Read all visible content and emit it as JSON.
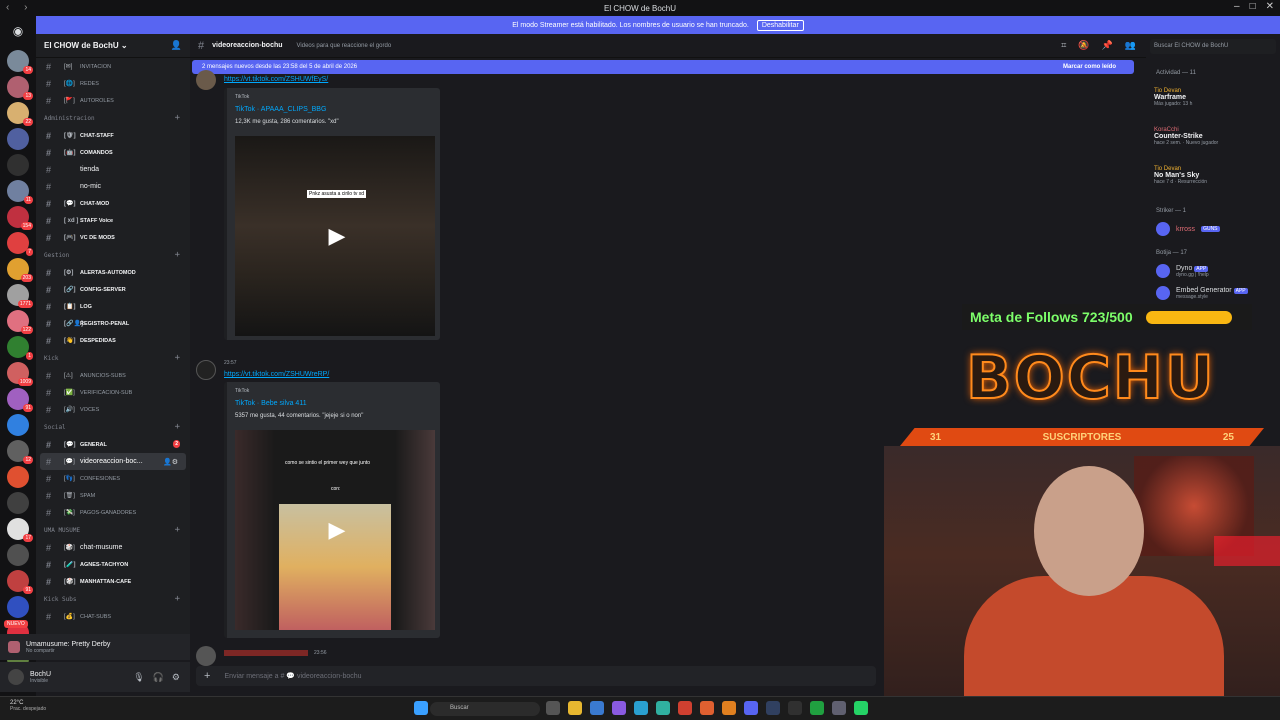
{
  "titlebar": {
    "title": "El CHOW de BochU"
  },
  "banner": {
    "text": "El modo Streamer está habilitado. Los nombres de usuario se han truncado.",
    "button": "Deshabilitar"
  },
  "servers": [
    {
      "count": "14",
      "color": "#7a8a9a"
    },
    {
      "count": "13",
      "color": "#b06070"
    },
    {
      "count": "22",
      "color": "#d8b070"
    },
    {
      "count": "",
      "color": "#5060a0"
    },
    {
      "count": "",
      "color": "#303030"
    },
    {
      "count": "11",
      "color": "#7080a0"
    },
    {
      "count": "154",
      "color": "#c03040"
    },
    {
      "count": "7",
      "color": "#e04040"
    },
    {
      "count": "203",
      "color": "#e0a030"
    },
    {
      "count": "1771",
      "color": "#a0a0a0"
    },
    {
      "count": "122",
      "color": "#e07080"
    },
    {
      "count": "1",
      "color": "#308030"
    },
    {
      "count": "1009",
      "color": "#d06060"
    },
    {
      "count": "91",
      "color": "#a060c0"
    },
    {
      "count": "",
      "color": "#3080e0"
    },
    {
      "count": "12",
      "color": "#606060"
    },
    {
      "count": "",
      "color": "#e05030"
    },
    {
      "count": "",
      "color": "#404040"
    },
    {
      "count": "17",
      "color": "#e0e0e0"
    },
    {
      "count": "",
      "color": "#505050"
    },
    {
      "count": "91",
      "color": "#c04040"
    },
    {
      "count": "",
      "color": "#3050c0"
    },
    {
      "count": "11",
      "color": "#e03040"
    },
    {
      "count": "17",
      "color": "#608040"
    }
  ],
  "server_new": "NUEVO",
  "guild": {
    "name": "El CHOW de BochU"
  },
  "channels": {
    "top": [
      {
        "emoji": "[✉]",
        "name": "INVITACION"
      },
      {
        "emoji": "[🌐]",
        "name": "REDES"
      },
      {
        "emoji": "[🚩]",
        "name": "AUTOROLES"
      }
    ],
    "cat_admin": "Administracion",
    "admin": [
      {
        "emoji": "[🛡]",
        "name": "CHAT-STAFF"
      },
      {
        "emoji": "[🤖]",
        "name": "COMANDOS"
      },
      {
        "emoji": "",
        "name": "tienda"
      },
      {
        "emoji": "",
        "name": "no-mic"
      },
      {
        "emoji": "[💬]",
        "name": "CHAT-MOD"
      },
      {
        "emoji": "[ xd ]",
        "name": "STAFF Voice"
      },
      {
        "emoji": "[🎮]",
        "name": "VC DE MODS"
      }
    ],
    "cat_gestion": "Gestion",
    "gestion": [
      {
        "emoji": "[⚙]",
        "name": "ALERTAS-AUTOMOD"
      },
      {
        "emoji": "[🔗]",
        "name": "CONFIG-SERVER"
      },
      {
        "emoji": "[📋]",
        "name": "LOG"
      },
      {
        "emoji": "[🔗👤]",
        "name": "REGISTRO-PENAL"
      },
      {
        "emoji": "[👋]",
        "name": "DESPEDIDAS"
      }
    ],
    "cat_kick": "Kick",
    "kick": [
      {
        "emoji": "[⚠]",
        "name": "ANUNCIOS-SUBS"
      },
      {
        "emoji": "[✅]",
        "name": "VERIFICACION-SUB"
      },
      {
        "emoji": "[🔊]",
        "name": "VOCES"
      }
    ],
    "cat_social": "Social",
    "social_general": {
      "emoji": "[💬]",
      "name": "GENERAL",
      "badge": "2"
    },
    "social_active": {
      "emoji": "[💬]",
      "name": "videoreaccion-boc..."
    },
    "social": [
      {
        "emoji": "[👣]",
        "name": "CONFESIONES"
      },
      {
        "emoji": "[🗑]",
        "name": "SPAM"
      },
      {
        "emoji": "[💸]",
        "name": "PAGOS-GANADORES"
      }
    ],
    "cat_uma": "UMA MUSUME",
    "uma": [
      {
        "emoji": "[🎲]",
        "name": "chat-musume"
      },
      {
        "emoji": "[🧪]",
        "name": "AGNES-TACHYON"
      },
      {
        "emoji": "[🎲]",
        "name": "MANHATTAN-CAFE"
      }
    ],
    "cat_kicksubs": "Kick Subs",
    "kicksubs": [
      {
        "emoji": "[💰]",
        "name": "CHAT-SUBS"
      }
    ]
  },
  "voice": {
    "title": "Umamusume: Pretty Derby",
    "sub": "No compartir"
  },
  "user": {
    "name": "BochU",
    "status": "Invisible"
  },
  "header": {
    "channel": "videoreaccion-bochu",
    "topic": "Videos para que reaccione el gordo",
    "search": "Buscar El CHOW de BochU"
  },
  "newbar": {
    "text": "2 mensajes nuevos desde las 23:58 del 5 de abril de 2026",
    "mark": "Marcar como leído"
  },
  "messages": [
    {
      "link": "https://vt.tiktok.com/ZSHUWfEyS/",
      "provider": "TikTok",
      "title": "TikTok · APAAA_CLIPS_BBG",
      "desc": "12,3K me gusta, 286 comentarios. \"xd\"",
      "caption": "Pnkz asusta a cirilo tv xd"
    },
    {
      "time": "23:57",
      "link": "https://vt.tiktok.com/ZSHUWreRP/",
      "provider": "TikTok",
      "title": "TikTok · Bebe silva 411",
      "desc": "5357 me gusta, 44 comentarios. \"jejeje si o non\"",
      "caption": "como se sintio el primer wey que junto",
      "caption2": "con:"
    }
  ],
  "last_msg": {
    "time": "23:56"
  },
  "composer": {
    "placeholder": "Enviar mensaje a # 💬 videoreaccion-bochu"
  },
  "members": {
    "activity_label": "Actividad — 11",
    "activities": [
      {
        "user": "Tio Devan",
        "game": "Warframe",
        "detail": "Más jugado: 13 h"
      },
      {
        "user": "KoraCchi",
        "game": "Counter-Strike",
        "detail": "hace 2 sem. · Nuevo jugador"
      },
      {
        "user": "Tio Devan",
        "game": "No Man's Sky",
        "detail": "hace 7 d · Resurrección"
      }
    ],
    "striker_label": "Striker — 1",
    "striker": {
      "name": "krross",
      "tag": "GUNS"
    },
    "botija_label": "Botija — 17",
    "bots": [
      {
        "name": "Dyno",
        "tag": "APP",
        "sub": "dyno.gg | !help"
      },
      {
        "name": "Embed Generator",
        "tag": "APP",
        "sub": "message.style"
      }
    ]
  },
  "overlay": {
    "goal": "Meta de Follows 723/500",
    "logo": "BOCHU",
    "subs_left": "31",
    "subs_label": "SUSCRIPTORES",
    "subs_right": "25"
  },
  "taskbar": {
    "temp": "22°C",
    "weather": "Prac. despejado",
    "search": "Buscar"
  }
}
